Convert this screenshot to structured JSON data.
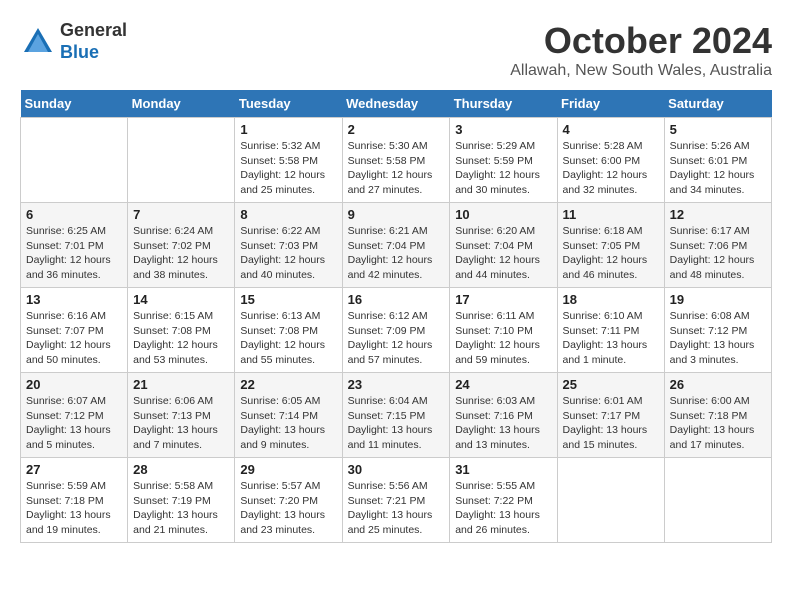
{
  "header": {
    "logo_line1": "General",
    "logo_line2": "Blue",
    "month": "October 2024",
    "location": "Allawah, New South Wales, Australia"
  },
  "weekdays": [
    "Sunday",
    "Monday",
    "Tuesday",
    "Wednesday",
    "Thursday",
    "Friday",
    "Saturday"
  ],
  "weeks": [
    [
      {
        "day": "",
        "info": ""
      },
      {
        "day": "",
        "info": ""
      },
      {
        "day": "1",
        "info": "Sunrise: 5:32 AM\nSunset: 5:58 PM\nDaylight: 12 hours\nand 25 minutes."
      },
      {
        "day": "2",
        "info": "Sunrise: 5:30 AM\nSunset: 5:58 PM\nDaylight: 12 hours\nand 27 minutes."
      },
      {
        "day": "3",
        "info": "Sunrise: 5:29 AM\nSunset: 5:59 PM\nDaylight: 12 hours\nand 30 minutes."
      },
      {
        "day": "4",
        "info": "Sunrise: 5:28 AM\nSunset: 6:00 PM\nDaylight: 12 hours\nand 32 minutes."
      },
      {
        "day": "5",
        "info": "Sunrise: 5:26 AM\nSunset: 6:01 PM\nDaylight: 12 hours\nand 34 minutes."
      }
    ],
    [
      {
        "day": "6",
        "info": "Sunrise: 6:25 AM\nSunset: 7:01 PM\nDaylight: 12 hours\nand 36 minutes."
      },
      {
        "day": "7",
        "info": "Sunrise: 6:24 AM\nSunset: 7:02 PM\nDaylight: 12 hours\nand 38 minutes."
      },
      {
        "day": "8",
        "info": "Sunrise: 6:22 AM\nSunset: 7:03 PM\nDaylight: 12 hours\nand 40 minutes."
      },
      {
        "day": "9",
        "info": "Sunrise: 6:21 AM\nSunset: 7:04 PM\nDaylight: 12 hours\nand 42 minutes."
      },
      {
        "day": "10",
        "info": "Sunrise: 6:20 AM\nSunset: 7:04 PM\nDaylight: 12 hours\nand 44 minutes."
      },
      {
        "day": "11",
        "info": "Sunrise: 6:18 AM\nSunset: 7:05 PM\nDaylight: 12 hours\nand 46 minutes."
      },
      {
        "day": "12",
        "info": "Sunrise: 6:17 AM\nSunset: 7:06 PM\nDaylight: 12 hours\nand 48 minutes."
      }
    ],
    [
      {
        "day": "13",
        "info": "Sunrise: 6:16 AM\nSunset: 7:07 PM\nDaylight: 12 hours\nand 50 minutes."
      },
      {
        "day": "14",
        "info": "Sunrise: 6:15 AM\nSunset: 7:08 PM\nDaylight: 12 hours\nand 53 minutes."
      },
      {
        "day": "15",
        "info": "Sunrise: 6:13 AM\nSunset: 7:08 PM\nDaylight: 12 hours\nand 55 minutes."
      },
      {
        "day": "16",
        "info": "Sunrise: 6:12 AM\nSunset: 7:09 PM\nDaylight: 12 hours\nand 57 minutes."
      },
      {
        "day": "17",
        "info": "Sunrise: 6:11 AM\nSunset: 7:10 PM\nDaylight: 12 hours\nand 59 minutes."
      },
      {
        "day": "18",
        "info": "Sunrise: 6:10 AM\nSunset: 7:11 PM\nDaylight: 13 hours\nand 1 minute."
      },
      {
        "day": "19",
        "info": "Sunrise: 6:08 AM\nSunset: 7:12 PM\nDaylight: 13 hours\nand 3 minutes."
      }
    ],
    [
      {
        "day": "20",
        "info": "Sunrise: 6:07 AM\nSunset: 7:12 PM\nDaylight: 13 hours\nand 5 minutes."
      },
      {
        "day": "21",
        "info": "Sunrise: 6:06 AM\nSunset: 7:13 PM\nDaylight: 13 hours\nand 7 minutes."
      },
      {
        "day": "22",
        "info": "Sunrise: 6:05 AM\nSunset: 7:14 PM\nDaylight: 13 hours\nand 9 minutes."
      },
      {
        "day": "23",
        "info": "Sunrise: 6:04 AM\nSunset: 7:15 PM\nDaylight: 13 hours\nand 11 minutes."
      },
      {
        "day": "24",
        "info": "Sunrise: 6:03 AM\nSunset: 7:16 PM\nDaylight: 13 hours\nand 13 minutes."
      },
      {
        "day": "25",
        "info": "Sunrise: 6:01 AM\nSunset: 7:17 PM\nDaylight: 13 hours\nand 15 minutes."
      },
      {
        "day": "26",
        "info": "Sunrise: 6:00 AM\nSunset: 7:18 PM\nDaylight: 13 hours\nand 17 minutes."
      }
    ],
    [
      {
        "day": "27",
        "info": "Sunrise: 5:59 AM\nSunset: 7:18 PM\nDaylight: 13 hours\nand 19 minutes."
      },
      {
        "day": "28",
        "info": "Sunrise: 5:58 AM\nSunset: 7:19 PM\nDaylight: 13 hours\nand 21 minutes."
      },
      {
        "day": "29",
        "info": "Sunrise: 5:57 AM\nSunset: 7:20 PM\nDaylight: 13 hours\nand 23 minutes."
      },
      {
        "day": "30",
        "info": "Sunrise: 5:56 AM\nSunset: 7:21 PM\nDaylight: 13 hours\nand 25 minutes."
      },
      {
        "day": "31",
        "info": "Sunrise: 5:55 AM\nSunset: 7:22 PM\nDaylight: 13 hours\nand 26 minutes."
      },
      {
        "day": "",
        "info": ""
      },
      {
        "day": "",
        "info": ""
      }
    ]
  ]
}
